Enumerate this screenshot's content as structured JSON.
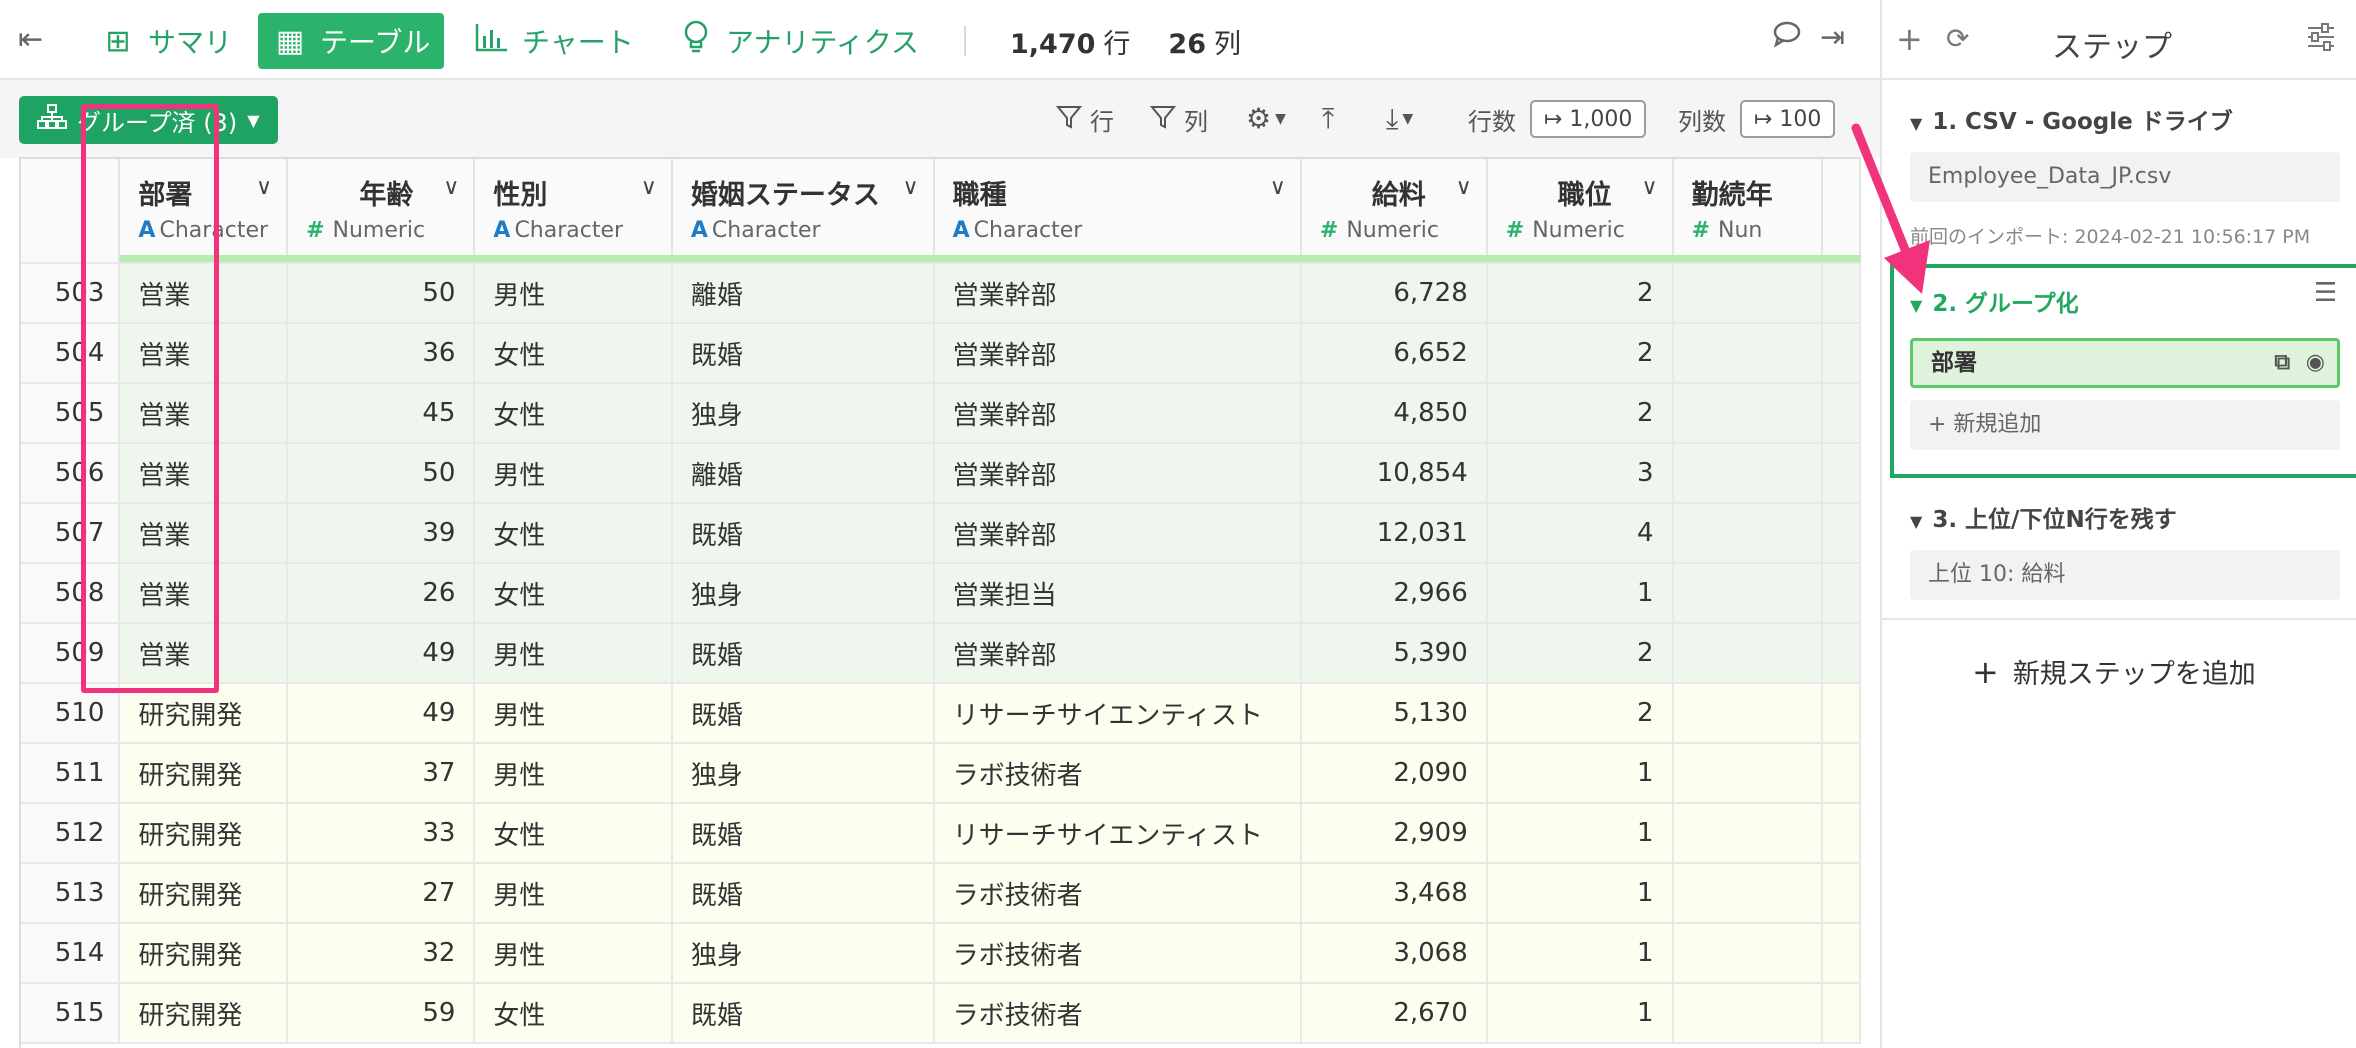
{
  "toolbar": {
    "tabs": [
      {
        "icon": "summary-icon",
        "label": "サマリ"
      },
      {
        "icon": "table-icon",
        "label": "テーブル"
      },
      {
        "icon": "chart-icon",
        "label": "チャート"
      },
      {
        "icon": "lightbulb-icon",
        "label": "アナリティクス"
      }
    ],
    "row_count": "1,470",
    "row_unit": "行",
    "col_count": "26",
    "col_unit": "列"
  },
  "subbar": {
    "group_button": "グループ済 (3)",
    "filter_row": "行",
    "filter_col": "列",
    "row_limit_label": "行数",
    "row_limit_value": "↦ 1,000",
    "col_limit_label": "列数",
    "col_limit_value": "↦ 100"
  },
  "table": {
    "columns": [
      {
        "name": "部署",
        "type": "Character",
        "type_glyph": "A"
      },
      {
        "name": "年齢",
        "type": "Numeric",
        "type_glyph": "#"
      },
      {
        "name": "性別",
        "type": "Character",
        "type_glyph": "A"
      },
      {
        "name": "婚姻ステータス",
        "type": "Character",
        "type_glyph": "A"
      },
      {
        "name": "職種",
        "type": "Character",
        "type_glyph": "A"
      },
      {
        "name": "給料",
        "type": "Numeric",
        "type_glyph": "#"
      },
      {
        "name": "職位",
        "type": "Numeric",
        "type_glyph": "#"
      },
      {
        "name": "勤続年",
        "type": "Nun",
        "type_glyph": "#"
      }
    ],
    "rows": [
      {
        "n": "503",
        "cells": [
          "営業",
          "50",
          "男性",
          "離婚",
          "営業幹部",
          "6,728",
          "2",
          ""
        ]
      },
      {
        "n": "504",
        "cells": [
          "営業",
          "36",
          "女性",
          "既婚",
          "営業幹部",
          "6,652",
          "2",
          ""
        ]
      },
      {
        "n": "505",
        "cells": [
          "営業",
          "45",
          "女性",
          "独身",
          "営業幹部",
          "4,850",
          "2",
          ""
        ]
      },
      {
        "n": "506",
        "cells": [
          "営業",
          "50",
          "男性",
          "離婚",
          "営業幹部",
          "10,854",
          "3",
          ""
        ]
      },
      {
        "n": "507",
        "cells": [
          "営業",
          "39",
          "女性",
          "既婚",
          "営業幹部",
          "12,031",
          "4",
          ""
        ]
      },
      {
        "n": "508",
        "cells": [
          "営業",
          "26",
          "女性",
          "独身",
          "営業担当",
          "2,966",
          "1",
          ""
        ]
      },
      {
        "n": "509",
        "cells": [
          "営業",
          "49",
          "男性",
          "既婚",
          "営業幹部",
          "5,390",
          "2",
          ""
        ]
      },
      {
        "n": "510",
        "cells": [
          "研究開発",
          "49",
          "男性",
          "既婚",
          "リサーチサイエンティスト",
          "5,130",
          "2",
          ""
        ]
      },
      {
        "n": "511",
        "cells": [
          "研究開発",
          "37",
          "男性",
          "独身",
          "ラボ技術者",
          "2,090",
          "1",
          ""
        ]
      },
      {
        "n": "512",
        "cells": [
          "研究開発",
          "33",
          "女性",
          "既婚",
          "リサーチサイエンティスト",
          "2,909",
          "1",
          ""
        ]
      },
      {
        "n": "513",
        "cells": [
          "研究開発",
          "27",
          "男性",
          "既婚",
          "ラボ技術者",
          "3,468",
          "1",
          ""
        ]
      },
      {
        "n": "514",
        "cells": [
          "研究開発",
          "32",
          "男性",
          "独身",
          "ラボ技術者",
          "3,068",
          "1",
          ""
        ]
      },
      {
        "n": "515",
        "cells": [
          "研究開発",
          "59",
          "女性",
          "既婚",
          "ラボ技術者",
          "2,670",
          "1",
          ""
        ]
      }
    ]
  },
  "panel": {
    "title": "ステップ",
    "steps": [
      {
        "title": "1. CSV - Google ドライブ",
        "detail": "Employee_Data_JP.csv",
        "note": "前回のインポート: 2024-02-21 10:56:17 PM"
      },
      {
        "title": "2. グループ化",
        "detail": "部署",
        "add": "+ 新規追加"
      },
      {
        "title": "3. 上位/下位N行を残す",
        "detail": "上位 10: 給料"
      }
    ],
    "add_step": "新規ステップを追加"
  },
  "colors": {
    "accent_green": "#2bb36c",
    "highlight_pink": "#f0337b",
    "group_border": "#22a85f"
  }
}
